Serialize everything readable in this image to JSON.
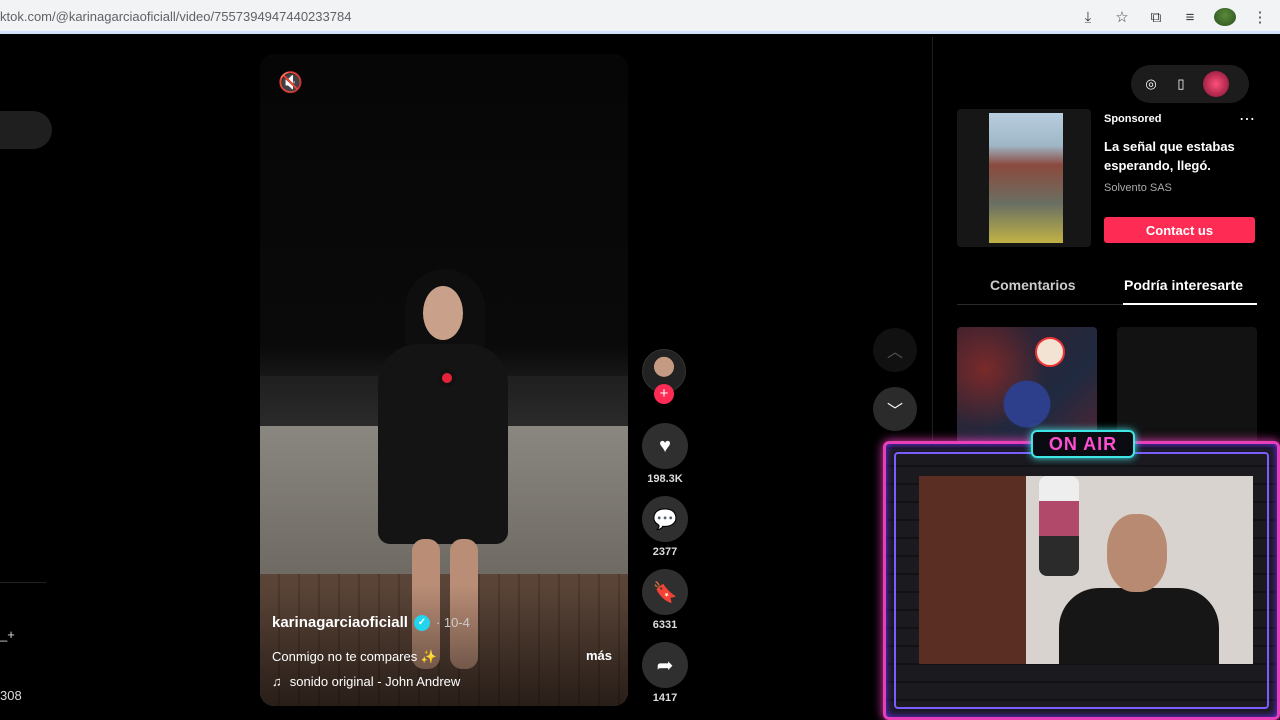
{
  "browser": {
    "url": "ktok.com/@karinagarciaoficiall/video/7557394947440233784",
    "icons": [
      "install-icon",
      "star-icon",
      "extensions-icon",
      "media-icon",
      "profile-icon",
      "menu-icon"
    ]
  },
  "sidebar": {
    "partial_text_1": "_+",
    "partial_text_2": "308"
  },
  "video": {
    "author": "karinagarciaoficiall",
    "date": "· 10-4",
    "caption": "Conmigo no te compares ✨",
    "more_label": "más",
    "music": "sonido original - John Andrew",
    "muted": true
  },
  "actions": {
    "likes": "198.3K",
    "comments": "2377",
    "saves": "6331",
    "shares": "1417"
  },
  "ad": {
    "sponsored": "Sponsored",
    "title": "La señal que estabas esperando, llegó.",
    "brand": "Solvento SAS",
    "cta": "Contact us"
  },
  "tabs": [
    {
      "label": "Comentarios",
      "active": false
    },
    {
      "label": "Podría interesarte",
      "active": true
    }
  ],
  "overlay": {
    "label": "ON AIR"
  },
  "colors": {
    "brand_red": "#fe2c55",
    "verified": "#20d5ec",
    "neon_pink": "#e83eb8",
    "neon_cyan": "#3ee6e6"
  }
}
